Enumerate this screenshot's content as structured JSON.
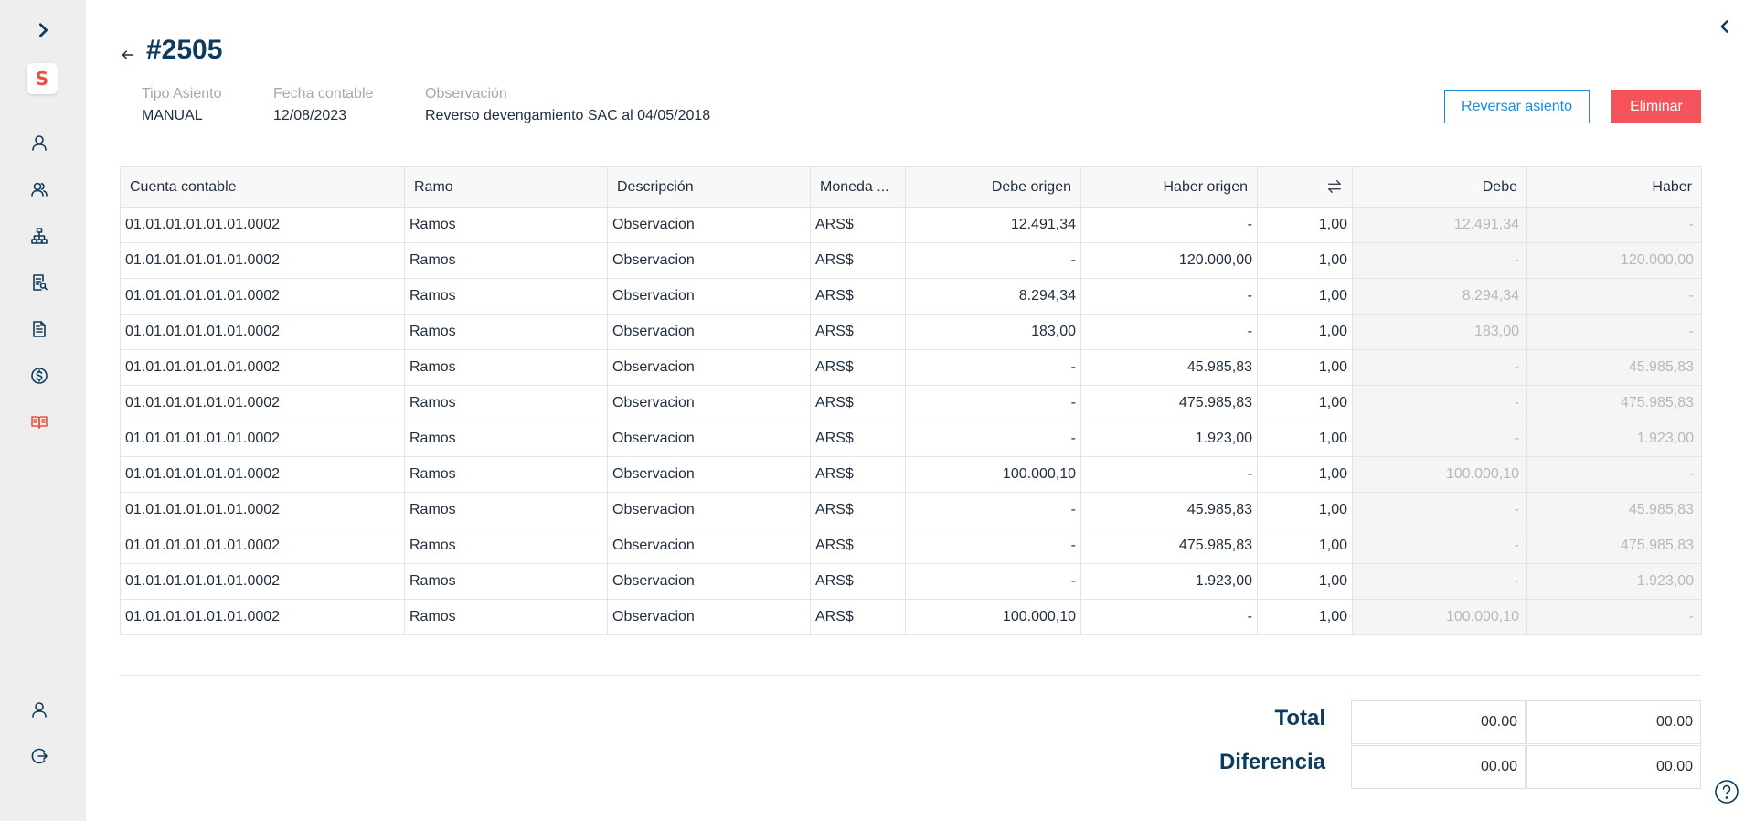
{
  "header": {
    "title": "#2505",
    "meta": [
      {
        "label": "Tipo Asiento",
        "value": "MANUAL"
      },
      {
        "label": "Fecha contable",
        "value": "12/08/2023"
      },
      {
        "label": "Observación",
        "value": "Reverso devengamiento SAC al 04/05/2018"
      }
    ],
    "reversar_label": "Reversar asiento",
    "eliminar_label": "Eliminar"
  },
  "sidebar": {
    "logo_text": "S",
    "items": [
      {
        "icon": "user-icon"
      },
      {
        "icon": "users-icon"
      },
      {
        "icon": "hierarchy-icon"
      },
      {
        "icon": "report-search-icon"
      },
      {
        "icon": "document-icon"
      },
      {
        "icon": "dollar-icon"
      },
      {
        "icon": "book-icon",
        "active": true
      }
    ],
    "bottom_items": [
      {
        "icon": "profile-icon"
      },
      {
        "icon": "logout-icon"
      }
    ]
  },
  "table": {
    "columns": [
      "Cuenta contable",
      "Ramo",
      "Descripción",
      "Moneda ...",
      "Debe origen",
      "Haber origen",
      "",
      "Debe",
      "Haber"
    ],
    "rows": [
      [
        "01.01.01.01.01.01.0002",
        "Ramos",
        "Observacion",
        "ARS$",
        "12.491,34",
        "-",
        "1,00",
        "12.491,34",
        "-"
      ],
      [
        "01.01.01.01.01.01.0002",
        "Ramos",
        "Observacion",
        "ARS$",
        "-",
        "120.000,00",
        "1,00",
        "-",
        "120.000,00"
      ],
      [
        "01.01.01.01.01.01.0002",
        "Ramos",
        "Observacion",
        "ARS$",
        "8.294,34",
        "-",
        "1,00",
        "8.294,34",
        "-"
      ],
      [
        "01.01.01.01.01.01.0002",
        "Ramos",
        "Observacion",
        "ARS$",
        "183,00",
        "-",
        "1,00",
        "183,00",
        "-"
      ],
      [
        "01.01.01.01.01.01.0002",
        "Ramos",
        "Observacion",
        "ARS$",
        "-",
        "45.985,83",
        "1,00",
        "-",
        "45.985,83"
      ],
      [
        "01.01.01.01.01.01.0002",
        "Ramos",
        "Observacion",
        "ARS$",
        "-",
        "475.985,83",
        "1,00",
        "-",
        "475.985,83"
      ],
      [
        "01.01.01.01.01.01.0002",
        "Ramos",
        "Observacion",
        "ARS$",
        "-",
        "1.923,00",
        "1,00",
        "-",
        "1.923,00"
      ],
      [
        "01.01.01.01.01.01.0002",
        "Ramos",
        "Observacion",
        "ARS$",
        "100.000,10",
        "-",
        "1,00",
        "100.000,10",
        "-"
      ],
      [
        "01.01.01.01.01.01.0002",
        "Ramos",
        "Observacion",
        "ARS$",
        "-",
        "45.985,83",
        "1,00",
        "-",
        "45.985,83"
      ],
      [
        "01.01.01.01.01.01.0002",
        "Ramos",
        "Observacion",
        "ARS$",
        "-",
        "475.985,83",
        "1,00",
        "-",
        "475.985,83"
      ],
      [
        "01.01.01.01.01.01.0002",
        "Ramos",
        "Observacion",
        "ARS$",
        "-",
        "1.923,00",
        "1,00",
        "-",
        "1.923,00"
      ],
      [
        "01.01.01.01.01.01.0002",
        "Ramos",
        "Observacion",
        "ARS$",
        "100.000,10",
        "-",
        "1,00",
        "100.000,10",
        "-"
      ]
    ]
  },
  "totals": {
    "total_label": "Total",
    "total_debe": "00.00",
    "total_haber": "00.00",
    "diferencia_label": "Diferencia",
    "diferencia_debe": "00.00",
    "diferencia_haber": "00.00"
  },
  "colors": {
    "primary": "#0e3a5c",
    "accent": "#e8533f",
    "danger": "#f4535b",
    "link": "#1f8ad6"
  }
}
